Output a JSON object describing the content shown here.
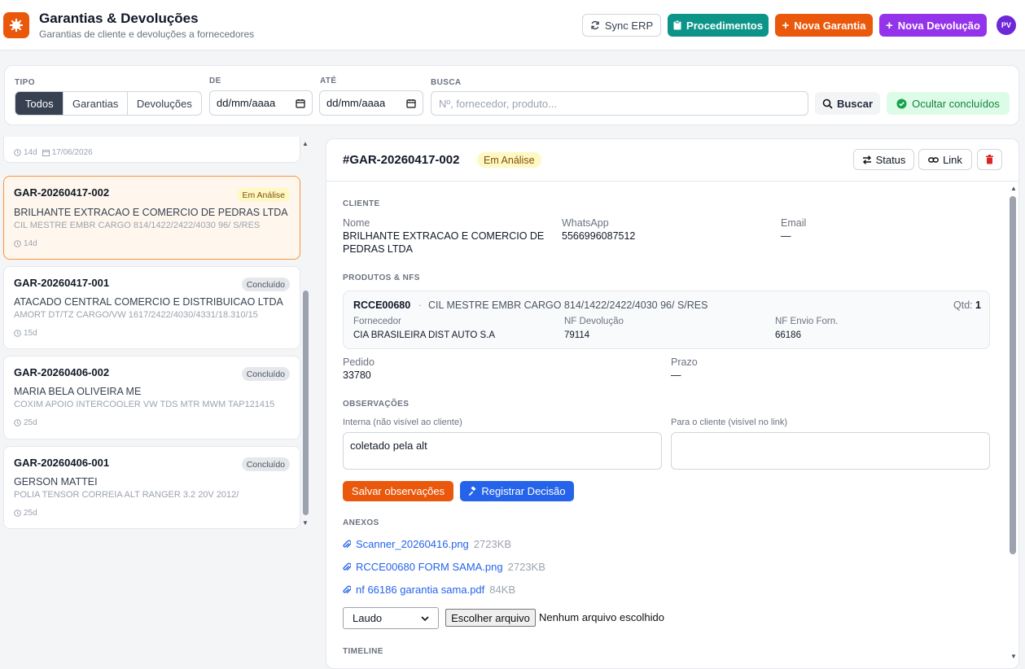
{
  "header": {
    "title": "Garantias & Devoluções",
    "subtitle": "Garantias de cliente e devoluções a fornecedores",
    "sync_label": "Sync ERP",
    "procedimentos_label": "Procedimentos",
    "nova_garantia_label": "Nova Garantia",
    "nova_devolucao_label": "Nova Devolução",
    "avatar_initials": "PV"
  },
  "filters": {
    "tipo_label": "TIPO",
    "tipo_options": [
      "Todos",
      "Garantias",
      "Devoluções"
    ],
    "tipo_selected": "Todos",
    "de_label": "DE",
    "de_value": "dd/mm/aaaa",
    "ate_label": "ATÉ",
    "ate_value": "dd/mm/aaaa",
    "busca_label": "BUSCA",
    "busca_placeholder": "Nº, fornecedor, produto...",
    "buscar_label": "Buscar",
    "ocultar_label": "Ocultar concluídos"
  },
  "list": {
    "partial_top": {
      "days": "14d",
      "date": "17/06/2026"
    },
    "items": [
      {
        "id": "GAR-20260417-002",
        "status": "Em Análise",
        "name": "BRILHANTE EXTRACAO E COMERCIO DE PEDRAS LTDA",
        "product": "CIL MESTRE EMBR CARGO 814/1422/2422/4030 96/ S/RES",
        "days": "14d"
      },
      {
        "id": "GAR-20260417-001",
        "status": "Concluído",
        "name": "ATACADO CENTRAL COMERCIO E DISTRIBUICAO LTDA",
        "product": "AMORT DT/TZ CARGO/VW 1617/2422/4030/4331/18.310/15",
        "days": "15d"
      },
      {
        "id": "GAR-20260406-002",
        "status": "Concluído",
        "name": "MARIA BELA OLIVEIRA ME",
        "product": "COXIM APOIO INTERCOOLER VW TDS MTR MWM TAP121415",
        "days": "25d"
      },
      {
        "id": "GAR-20260406-001",
        "status": "Concluído",
        "name": "GERSON MATTEI",
        "product": "POLIA TENSOR CORREIA ALT RANGER 3.2 20V 2012/",
        "days": "25d"
      }
    ]
  },
  "detail": {
    "id": "#GAR-20260417-002",
    "status": "Em Análise",
    "status_btn": "Status",
    "link_btn": "Link",
    "cliente_section": "CLIENTE",
    "nome_label": "Nome",
    "nome_line1": "BRILHANTE EXTRACAO E COMERCIO DE",
    "nome_line2": "PEDRAS LTDA",
    "whatsapp_label": "WhatsApp",
    "whatsapp_value": "5566996087512",
    "email_label": "Email",
    "email_value": "—",
    "produtos_section": "PRODUTOS & NFS",
    "product_code": "RCCE00680",
    "product_sep": "·",
    "product_desc": "CIL MESTRE EMBR CARGO 814/1422/2422/4030 96/ S/RES",
    "qtd_label": "Qtd:",
    "qtd_value": "1",
    "fornecedor_label": "Fornecedor",
    "fornecedor_value": "CIA BRASILEIRA DIST AUTO S.A",
    "nf_dev_label": "NF Devolução",
    "nf_dev_value": "79114",
    "nf_envio_label": "NF Envio Forn.",
    "nf_envio_value": "66186",
    "pedido_label": "Pedido",
    "pedido_value": "33780",
    "prazo_label": "Prazo",
    "prazo_value": "—",
    "obs_section": "OBSERVAÇÕES",
    "obs_interna_label": "Interna (não visível ao cliente)",
    "obs_interna_value": "coletado pela alt",
    "obs_cliente_label": "Para o cliente (visível no link)",
    "obs_cliente_value": "",
    "salvar_label": "Salvar observações",
    "registrar_label": "Registrar Decisão",
    "anexos_section": "ANEXOS",
    "attachments": [
      {
        "name": "Scanner_20260416.png",
        "size": "2723KB"
      },
      {
        "name": "RCCE00680 FORM SAMA.png",
        "size": "2723KB"
      },
      {
        "name": "nf 66186 garantia sama.pdf",
        "size": "84KB"
      }
    ],
    "anexo_type": "Laudo",
    "file_button": "Escolher arquivo",
    "file_status": "Nenhum arquivo escolhido",
    "timeline_section": "TIMELINE"
  }
}
